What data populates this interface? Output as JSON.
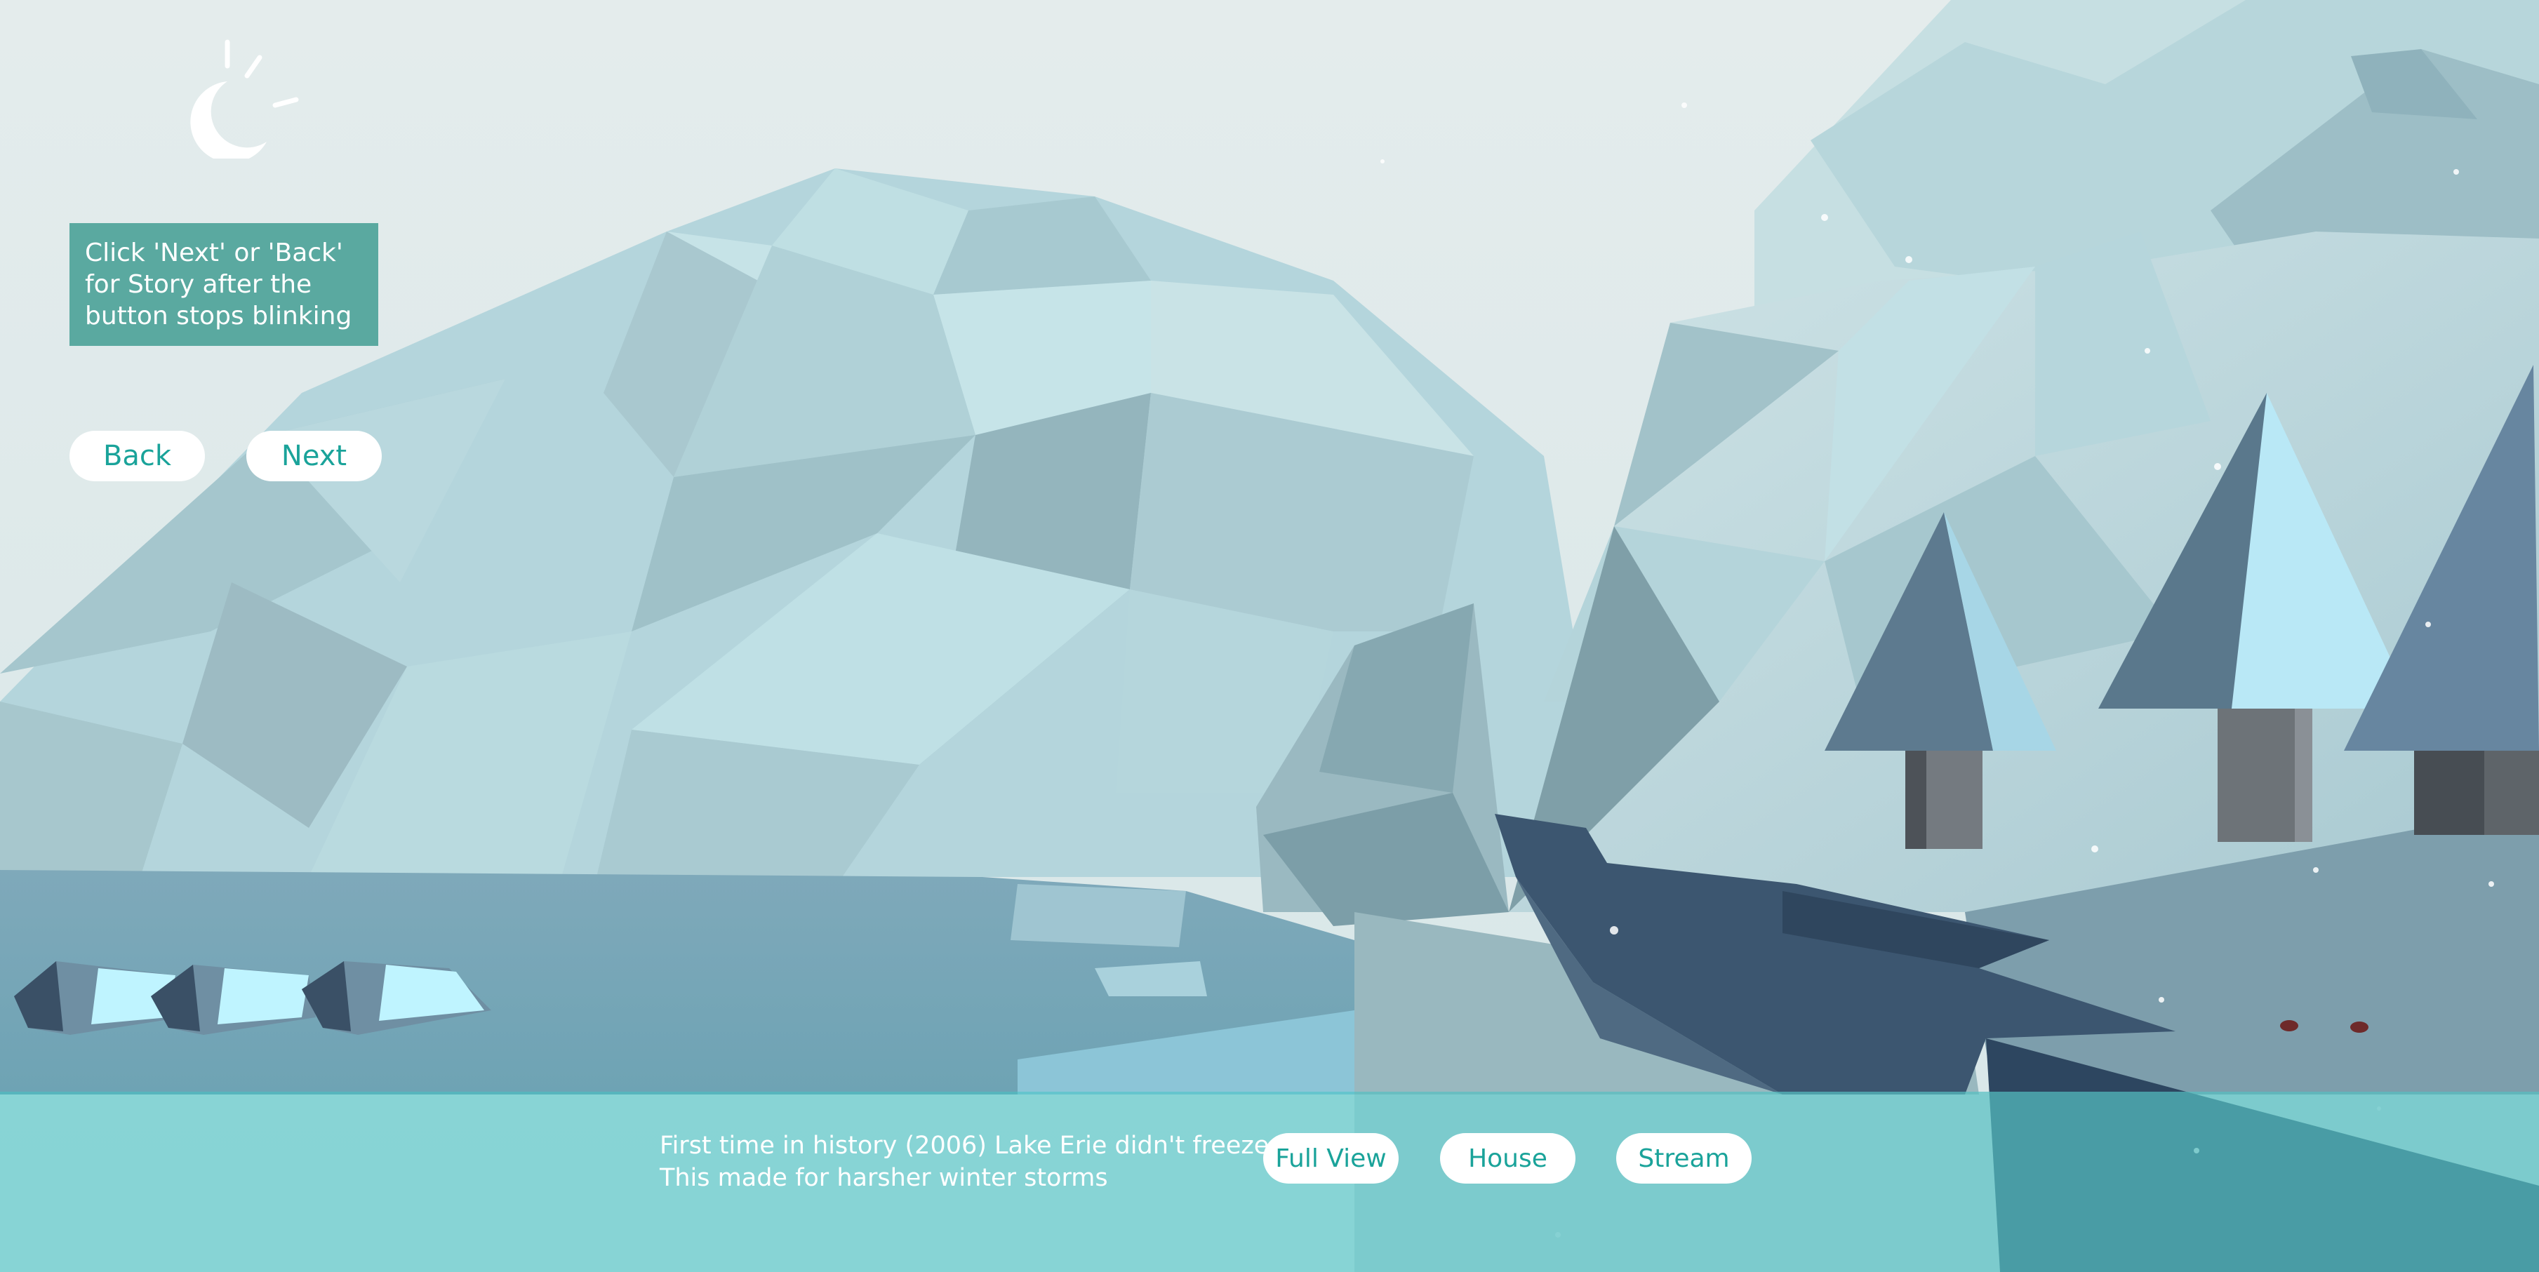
{
  "instruction": {
    "text": "Click 'Next' or 'Back' for Story after the button stops blinking"
  },
  "nav": {
    "back_label": "Back",
    "next_label": "Next"
  },
  "caption": {
    "line1": "First time in history (2006) Lake Erie didn't freeze.",
    "line2": "This made for harsher winter storms"
  },
  "views": {
    "full_view_label": "Full View",
    "house_label": "House",
    "stream_label": "Stream"
  },
  "logo": {
    "icon": "moon-sun-icon"
  },
  "colors": {
    "accent": "#1aa39a",
    "instruction_bg": "#5aa9a0",
    "button_bg": "#ffffff",
    "sky": "#e3ebeb",
    "bottom_bar": "#46c4c4"
  }
}
